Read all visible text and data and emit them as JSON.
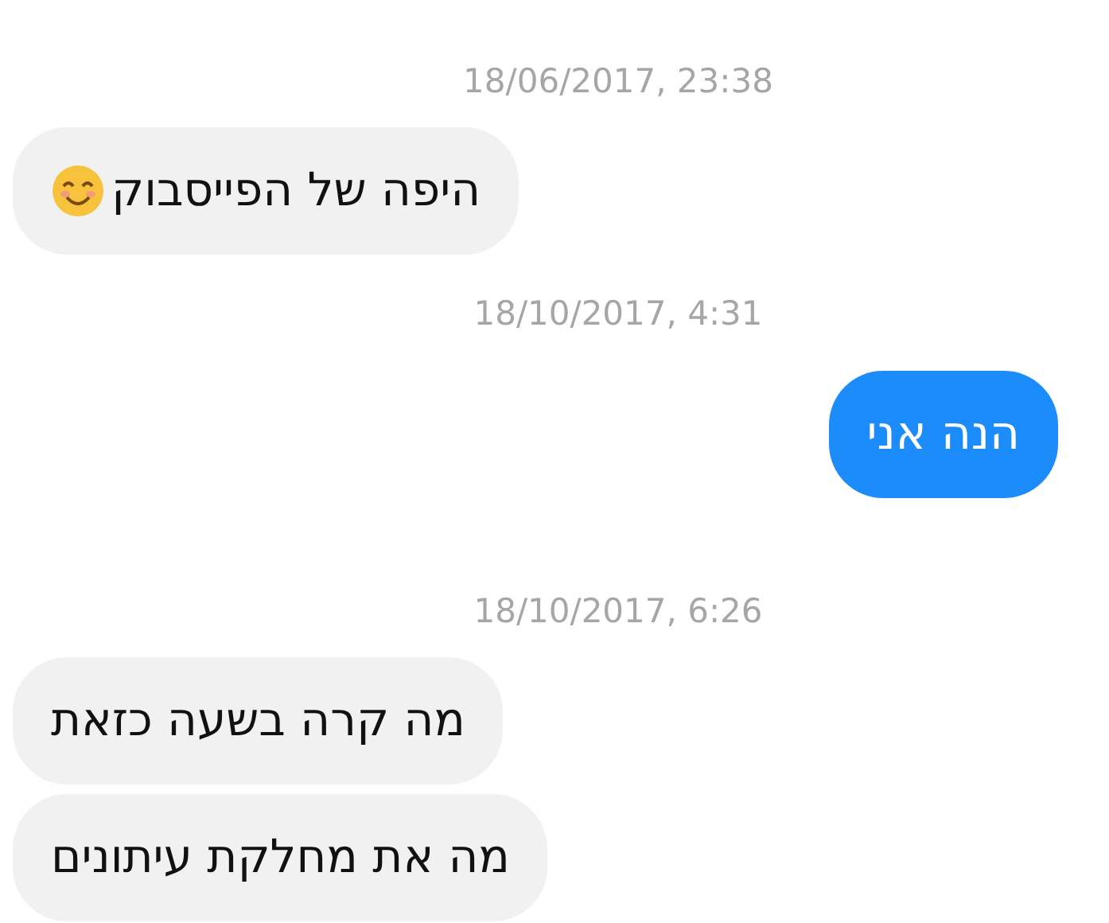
{
  "messages": [
    {
      "kind": "timestamp",
      "text": "18/06/2017, 23:38"
    },
    {
      "kind": "received",
      "text": "היפה של הפייסבוק",
      "emoji": true
    },
    {
      "kind": "timestamp",
      "text": "18/10/2017, 4:31"
    },
    {
      "kind": "sent",
      "text": "הנה אני",
      "emoji": false
    },
    {
      "kind": "timestamp",
      "text": "18/10/2017, 6:26"
    },
    {
      "kind": "received",
      "text": "מה קרה בשעה כזאת",
      "emoji": false
    },
    {
      "kind": "received",
      "text": "מה את מחלקת עיתונים",
      "emoji": false
    }
  ]
}
